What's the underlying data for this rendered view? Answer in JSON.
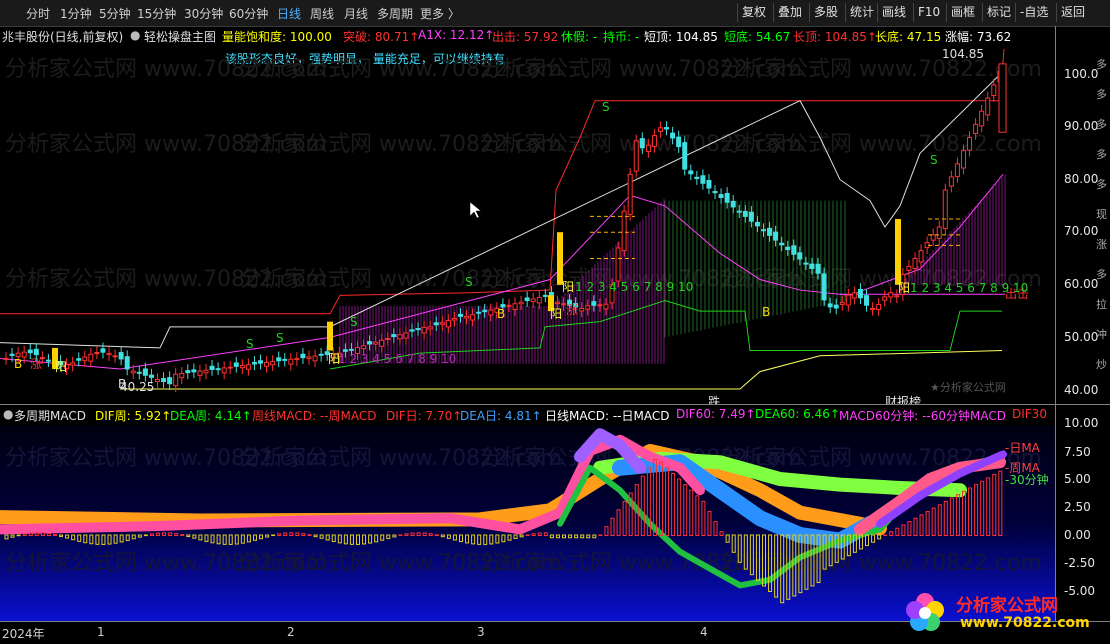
{
  "toolbar": {
    "left": [
      "分时",
      "1分钟",
      "5分钟",
      "15分钟",
      "30分钟",
      "60分钟",
      "日线",
      "周线",
      "月线",
      "多周期",
      "更多 〉"
    ],
    "active_index": 6,
    "right": [
      "复权",
      "叠加",
      "多股",
      "统计",
      "画线",
      "F10",
      "画框",
      "标记",
      "-自选",
      "返回"
    ]
  },
  "infobar": {
    "stock": "兆丰股份(日线,前复权)",
    "indicator": "轻松操盘主图",
    "items": [
      {
        "text": "量能饱和度: 100.00",
        "color": "#ffff00"
      },
      {
        "text": "突破: 80.71↑",
        "color": "#ff3030"
      },
      {
        "text": "A1X: 12.12↑",
        "color": "#ff40ff"
      },
      {
        "text": "出击: 57.92",
        "color": "#ff3030"
      },
      {
        "text": "休假: -",
        "color": "#00ff00"
      },
      {
        "text": "持币: -",
        "color": "#00ff00"
      },
      {
        "text": "短顶: 104.85",
        "color": "#ffffff"
      },
      {
        "text": "短底: 54.67",
        "color": "#00ff00"
      },
      {
        "text": "长顶: 104.85↑",
        "color": "#ff3030"
      },
      {
        "text": "长底: 47.15",
        "color": "#ffff00"
      },
      {
        "text": "涨幅: 73.62",
        "color": "#ffffff"
      }
    ],
    "note": "该股形态良好，强势明显，  量能充足，可以继续持有"
  },
  "main_chart": {
    "ylabels": [
      "100.0",
      "90.00",
      "80.00",
      "70.00",
      "60.00",
      "50.00",
      "40.00"
    ],
    "side_labels": [
      "多",
      "多",
      "多",
      "多",
      "多",
      "现",
      "涨",
      "多",
      "拉",
      "冲",
      "炒"
    ],
    "annotations": {
      "high_label": "104.85",
      "low_label": "40.25",
      "attack_label": "出击",
      "fall_label": "跌",
      "finance_label": "财报榜",
      "yang": "阳",
      "zhang": "涨",
      "seq": "1 2 3 4 5 6 7 8 9 10",
      "s": "S",
      "b": "B",
      "watermark_small": "★分析家公式网"
    }
  },
  "macd": {
    "title": "多周期MACD",
    "items": [
      {
        "text": "DIF周: 5.92↑",
        "color": "#ffff00"
      },
      {
        "text": "DEA周: 4.14↑",
        "color": "#00ff00"
      },
      {
        "text": "周线MACD: --周MACD",
        "color": "#ff3030"
      },
      {
        "text": "DIF日: 7.70↑",
        "color": "#ff3030"
      },
      {
        "text": "DEA日: 4.81↑",
        "color": "#40a0ff"
      },
      {
        "text": "日线MACD: --日MACD",
        "color": "#ffffff"
      },
      {
        "text": "DIF60: 7.49↑",
        "color": "#ff40ff"
      },
      {
        "text": "DEA60: 6.46↑",
        "color": "#00ff00"
      },
      {
        "text": "MACD60分钟: --60分钟MACD",
        "color": "#ff40ff"
      },
      {
        "text": "DIF30",
        "color": "#ff3030"
      }
    ],
    "ylabels": [
      "10.00",
      "7.50",
      "5.00",
      "2.50",
      "0.00",
      "-2.50",
      "-5.00"
    ],
    "right_labels": [
      "日MA",
      "周MA",
      "30分钟"
    ]
  },
  "xaxis": {
    "labels": [
      "2024年",
      "1",
      "2",
      "3",
      "4"
    ]
  },
  "watermark": "分析家公式网  www.70822.com",
  "logo": {
    "title": "分析家公式网",
    "url": "www.70822.com"
  }
}
